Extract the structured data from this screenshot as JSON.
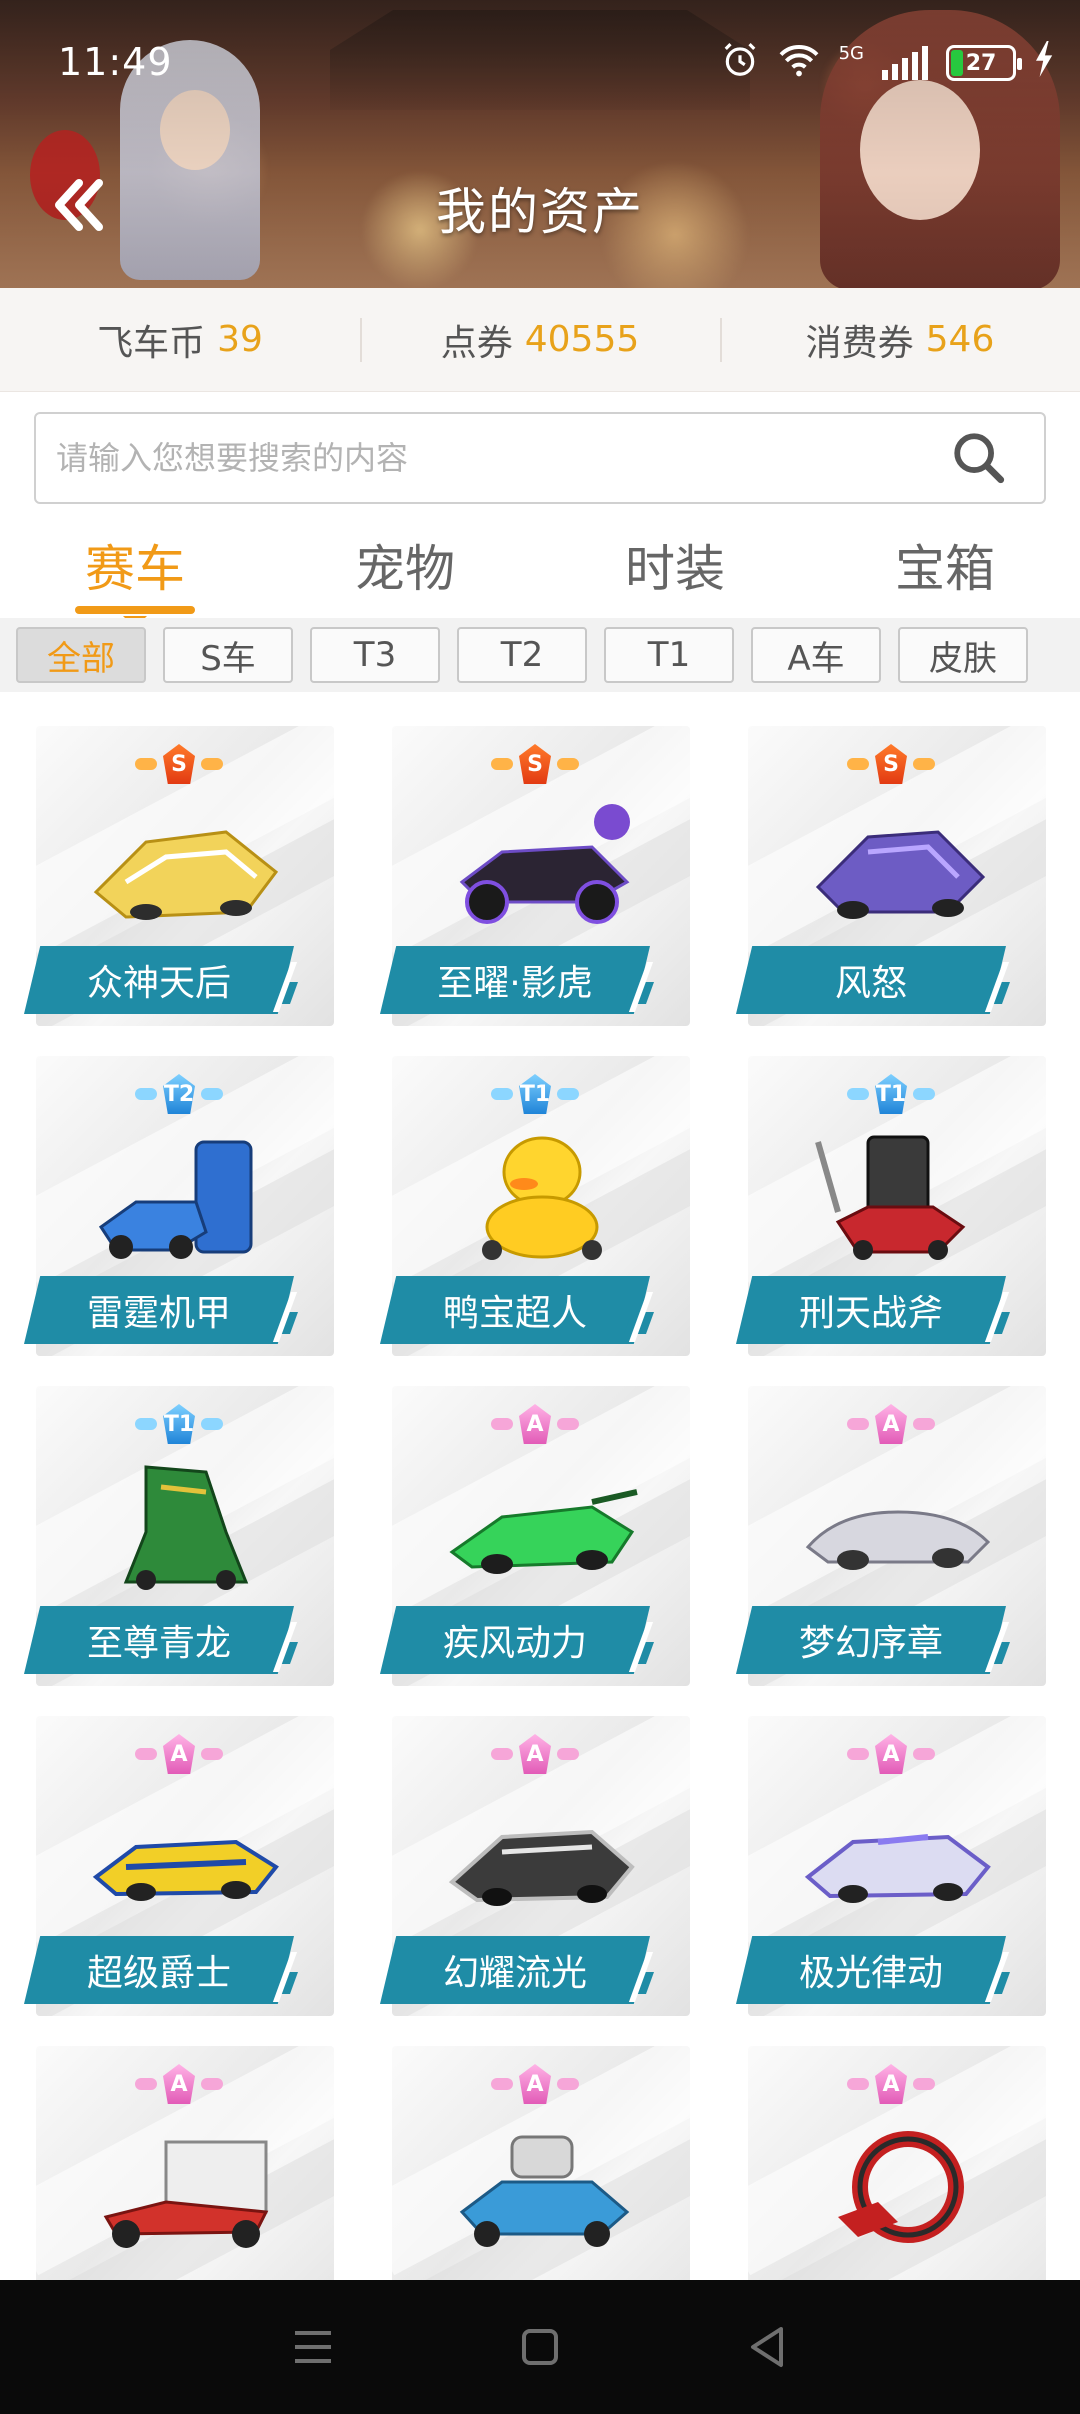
{
  "status_bar": {
    "time": "11:49",
    "network": "5G",
    "battery": "27"
  },
  "header": {
    "title": "我的资产"
  },
  "currencies": [
    {
      "label": "飞车币",
      "value": "39"
    },
    {
      "label": "点券",
      "value": "40555"
    },
    {
      "label": "消费券",
      "value": "546"
    }
  ],
  "search": {
    "placeholder": "请输入您想要搜索的内容"
  },
  "tabs": [
    "赛车",
    "宠物",
    "时装",
    "宝箱"
  ],
  "filters": [
    "全部",
    "S车",
    "T3",
    "T2",
    "T1",
    "A车",
    "皮肤"
  ],
  "items": [
    {
      "name": "众神天后",
      "tier": "S"
    },
    {
      "name": "至曜·影虎",
      "tier": "S"
    },
    {
      "name": "风怒",
      "tier": "S"
    },
    {
      "name": "雷霆机甲",
      "tier": "T2"
    },
    {
      "name": "鸭宝超人",
      "tier": "T1"
    },
    {
      "name": "刑天战斧",
      "tier": "T1"
    },
    {
      "name": "至尊青龙",
      "tier": "T1"
    },
    {
      "name": "疾风动力",
      "tier": "A"
    },
    {
      "name": "梦幻序章",
      "tier": "A"
    },
    {
      "name": "超级爵士",
      "tier": "A"
    },
    {
      "name": "幻耀流光",
      "tier": "A"
    },
    {
      "name": "极光律动",
      "tier": "A"
    },
    {
      "name": "",
      "tier": "A"
    },
    {
      "name": "",
      "tier": "A"
    },
    {
      "name": "",
      "tier": "A"
    }
  ],
  "colors": {
    "accent": "#f19a17",
    "nameplate": "#1f8ca6",
    "currency_value": "#e8a21a"
  }
}
